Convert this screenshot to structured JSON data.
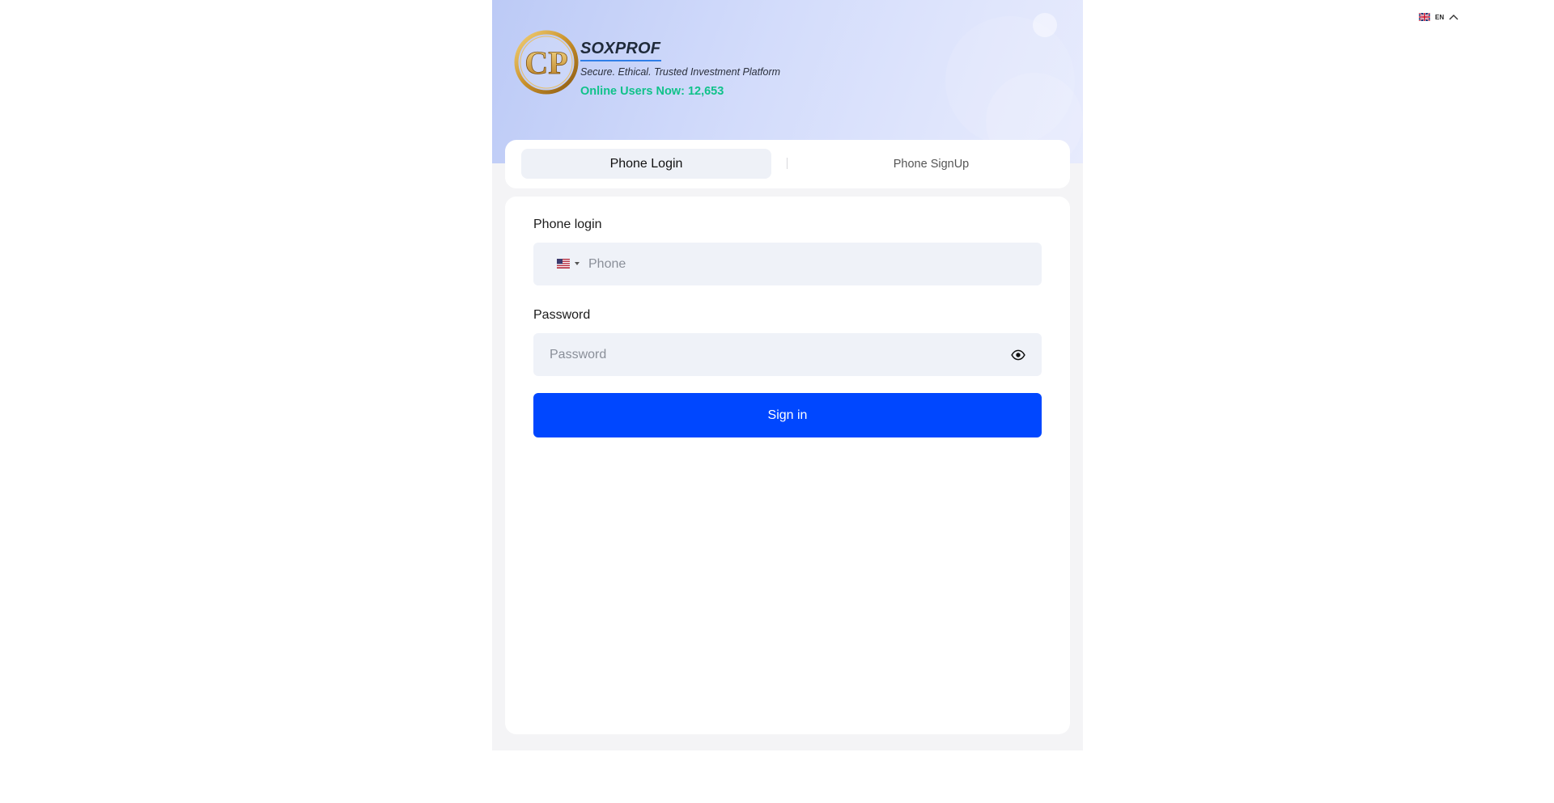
{
  "language": {
    "code": "EN",
    "flag_icon": "uk-flag-icon",
    "caret_icon": "chevron-up-icon"
  },
  "brand": {
    "logo_text": "CP",
    "name": "SOXPROF",
    "tagline": "Secure. Ethical. Trusted Investment Platform",
    "online_users": "Online Users Now: 12,653"
  },
  "tabs": [
    {
      "label": "Phone Login",
      "active": true
    },
    {
      "label": "Phone SignUp",
      "active": false
    }
  ],
  "form": {
    "phone_label": "Phone login",
    "phone_placeholder": "Phone",
    "phone_value": "",
    "country_flag_icon": "us-flag-icon",
    "password_label": "Password",
    "password_placeholder": "Password",
    "password_value": "",
    "toggle_icon": "eye-icon",
    "submit_label": "Sign in"
  },
  "colors": {
    "primary": "#0047ff",
    "online_green": "#10c28a",
    "input_bg": "#eff2f8",
    "page_bg": "#f4f4f6",
    "hero_start": "#bccaf6"
  }
}
